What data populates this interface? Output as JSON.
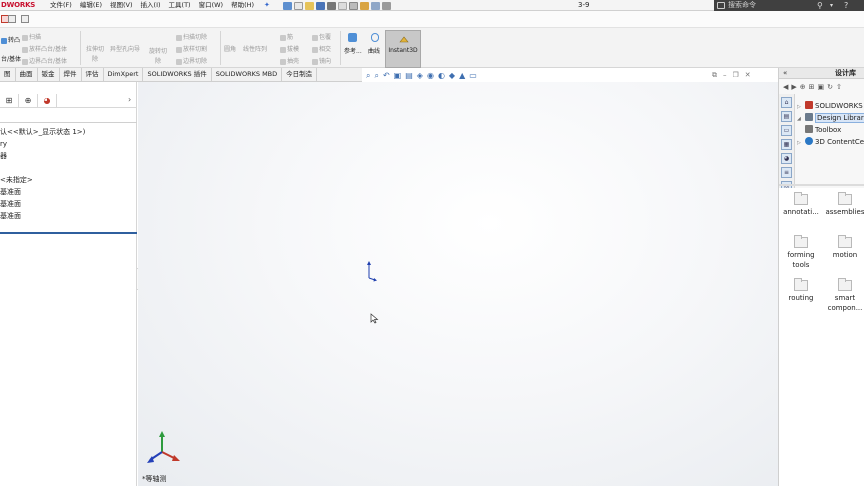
{
  "app": {
    "logo": "DWORKS",
    "document_title": "3-9",
    "menus": [
      "文件(F)",
      "编辑(E)",
      "视图(V)",
      "插入(I)",
      "工具(T)",
      "窗口(W)",
      "帮助(H)"
    ],
    "search": {
      "placeholder": "搜索命令"
    }
  },
  "ribbon": {
    "left_big": [
      "转凸",
      "台/基体"
    ],
    "group1": [
      "扫描",
      "放样凸台/基体",
      "边界凸台/基体"
    ],
    "group2": [
      "拉伸切",
      "除"
    ],
    "group3": [
      "异型孔向导"
    ],
    "group4": [
      "旋转切",
      "除"
    ],
    "group5": [
      "扫描切除",
      "放样切割",
      "边界切除"
    ],
    "group6": [
      "圆角",
      "线性阵列"
    ],
    "group7": [
      "筋",
      "拔模",
      "抽壳"
    ],
    "group8": [
      "包覆",
      "相交",
      "镜向"
    ],
    "reference": "参考...",
    "curves": "曲线",
    "instant3d": "Instant3D"
  },
  "command_tabs": [
    "图",
    "曲面",
    "钣金",
    "焊件",
    "评估",
    "DimXpert",
    "SOLIDWORKS 插件",
    "SOLIDWORKS MBD",
    "今日制造"
  ],
  "feature_tree": {
    "lines": [
      "认<<默认>_显示状态 1>)",
      "ry",
      "器",
      "",
      "<未指定>",
      "基准面",
      "基准面",
      "基准面"
    ]
  },
  "viewport": {
    "view_label": "*等轴测"
  },
  "task_pane": {
    "title": "设计库",
    "tree": [
      {
        "label": "SOLIDWORKS 内容",
        "color": "#c0392b"
      },
      {
        "label": "Design Library",
        "color": "#6b7b8c",
        "selected": true
      },
      {
        "label": "Toolbox",
        "color": "#777777"
      },
      {
        "label": "3D ContentCentral",
        "color": "#2b78c5"
      }
    ],
    "folders": [
      {
        "label": "annotati..."
      },
      {
        "label": "assemblies"
      },
      {
        "label": "forming tools"
      },
      {
        "label": "motion"
      },
      {
        "label": "routing"
      },
      {
        "label": "smart compon..."
      }
    ]
  },
  "colors": {
    "brand": "#c8102e",
    "panel_accent": "#2f5f9e",
    "instant3d_active": "#c8c8c8"
  }
}
